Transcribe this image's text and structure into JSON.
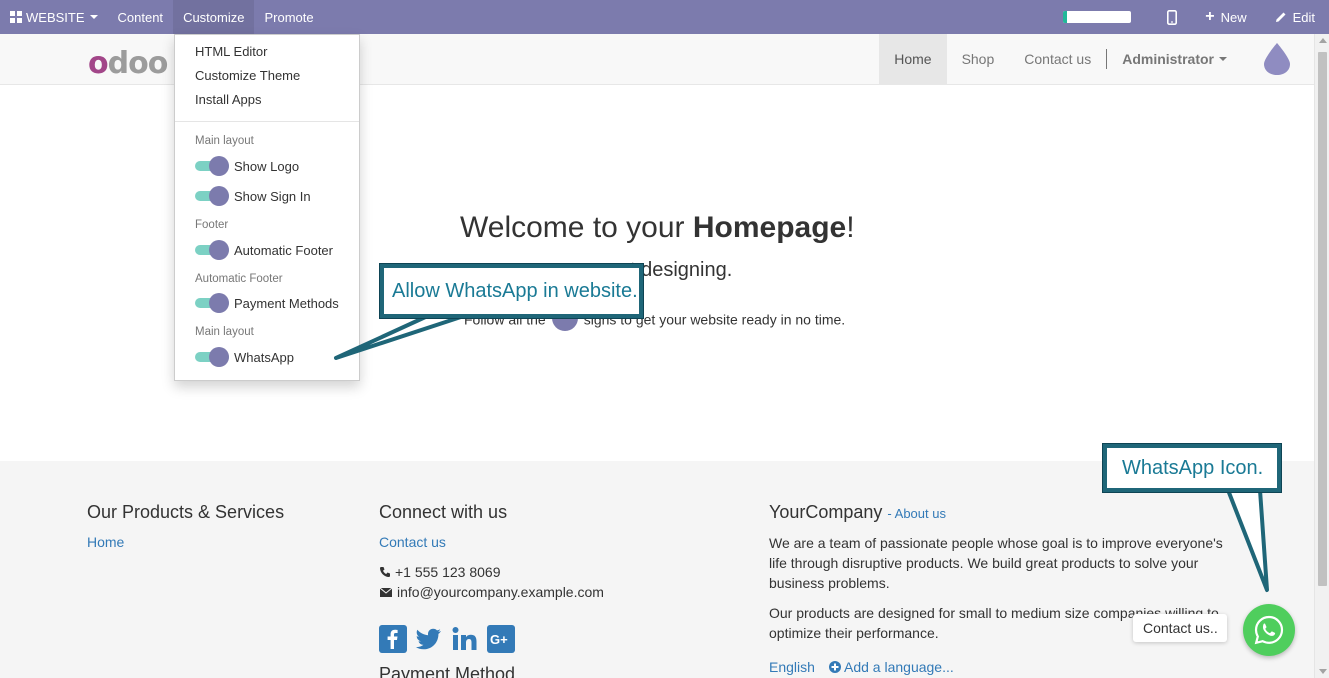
{
  "topbar": {
    "website_label": "WEBSITE",
    "menus": [
      "Content",
      "Customize",
      "Promote"
    ],
    "progress_fraction": 0.05,
    "new_label": "New",
    "edit_label": "Edit"
  },
  "header": {
    "logo_text": "odoo",
    "nav": [
      "Home",
      "Shop",
      "Contact us"
    ],
    "user": "Administrator"
  },
  "customize_menu": {
    "items": [
      "HTML Editor",
      "Customize Theme",
      "Install Apps"
    ],
    "sections": [
      {
        "header": "Main layout",
        "toggles": [
          "Show Logo",
          "Show Sign In"
        ]
      },
      {
        "header": "Footer",
        "toggles": [
          "Automatic Footer"
        ]
      },
      {
        "header": "Automatic Footer",
        "toggles": [
          "Payment Methods"
        ]
      },
      {
        "header": "Main layout",
        "toggles": [
          "WhatsApp"
        ]
      }
    ]
  },
  "hero": {
    "title_prefix": "Welcome to your ",
    "title_bold": "Homepage",
    "title_suffix": "!",
    "subtitle_visible": "t designing.",
    "text_before": "Follow all the",
    "text_after": "signs to get your website ready in no time."
  },
  "callouts": {
    "allow_whatsapp": "Allow WhatsApp in website.",
    "whatsapp_icon": "WhatsApp Icon."
  },
  "footer": {
    "col1": {
      "heading": "Our Products & Services",
      "links": [
        "Home"
      ]
    },
    "col2": {
      "heading": "Connect with us",
      "link": "Contact us",
      "phone": "+1 555 123 8069",
      "email": "info@yourcompany.example.com",
      "payment_heading": "Payment Method"
    },
    "col3": {
      "heading": "YourCompany",
      "about_link": "- About us",
      "para1": "We are a team of passionate people whose goal is to improve everyone's life through disruptive products. We build great products to solve your business problems.",
      "para2": "Our products are designed for small to medium size companies willing to optimize their performance.",
      "language": "English",
      "add_language": "Add a language..."
    }
  },
  "whatsapp": {
    "bubble": "Contact us.."
  },
  "colors": {
    "topbar": "#7c7bad",
    "whatsapp": "#4fce5d",
    "callout_border": "#1f6678",
    "toggle_track": "#7cd1c4",
    "link": "#337ab7"
  }
}
